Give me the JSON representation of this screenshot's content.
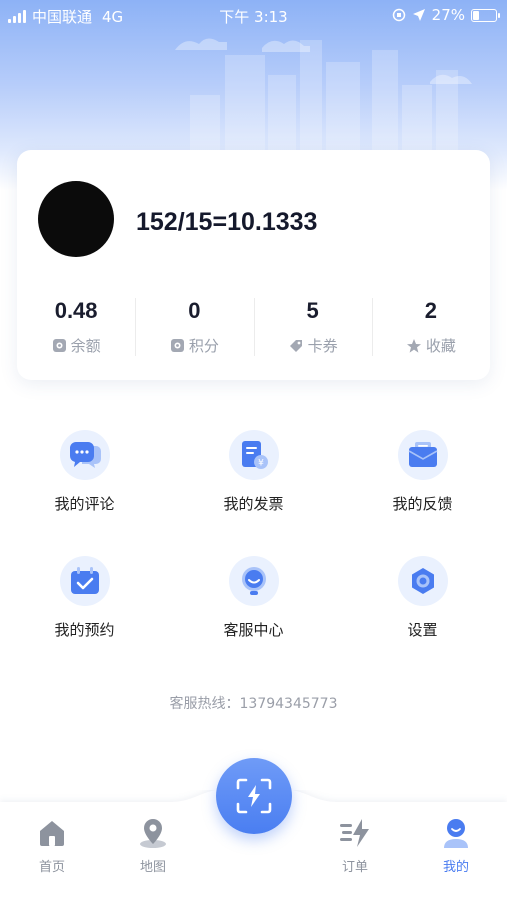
{
  "status_bar": {
    "carrier": "中国联通",
    "network": "4G",
    "time": "下午 3:13",
    "battery": "27%",
    "battery_level": 0.27
  },
  "profile": {
    "username": "152/15=10.1333",
    "stats": [
      {
        "value": "0.48",
        "label": "余额",
        "icon": "wallet-icon"
      },
      {
        "value": "0",
        "label": "积分",
        "icon": "points-icon"
      },
      {
        "value": "5",
        "label": "卡券",
        "icon": "coupon-tag-icon"
      },
      {
        "value": "2",
        "label": "收藏",
        "icon": "star-icon"
      }
    ]
  },
  "menu": [
    {
      "label": "我的评论",
      "icon": "comment-bubble-icon"
    },
    {
      "label": "我的发票",
      "icon": "invoice-icon"
    },
    {
      "label": "我的反馈",
      "icon": "feedback-mailbox-icon"
    },
    {
      "label": "我的预约",
      "icon": "calendar-check-icon"
    },
    {
      "label": "客服中心",
      "icon": "customer-service-icon"
    },
    {
      "label": "设置",
      "icon": "gear-icon"
    }
  ],
  "hotline": "客服热线：13794345773",
  "tabbar": {
    "tabs": [
      {
        "label": "首页",
        "icon": "home-icon"
      },
      {
        "label": "地图",
        "icon": "map-pin-icon"
      },
      {
        "label": "订单",
        "icon": "order-lightning-icon"
      },
      {
        "label": "我的",
        "icon": "profile-icon"
      }
    ],
    "active": "我的",
    "center_icon": "scan-charge-icon"
  },
  "colors": {
    "accent": "#4a7cf0",
    "icon_bg": "#eaf1fe",
    "muted_text": "#9aa0ac"
  }
}
